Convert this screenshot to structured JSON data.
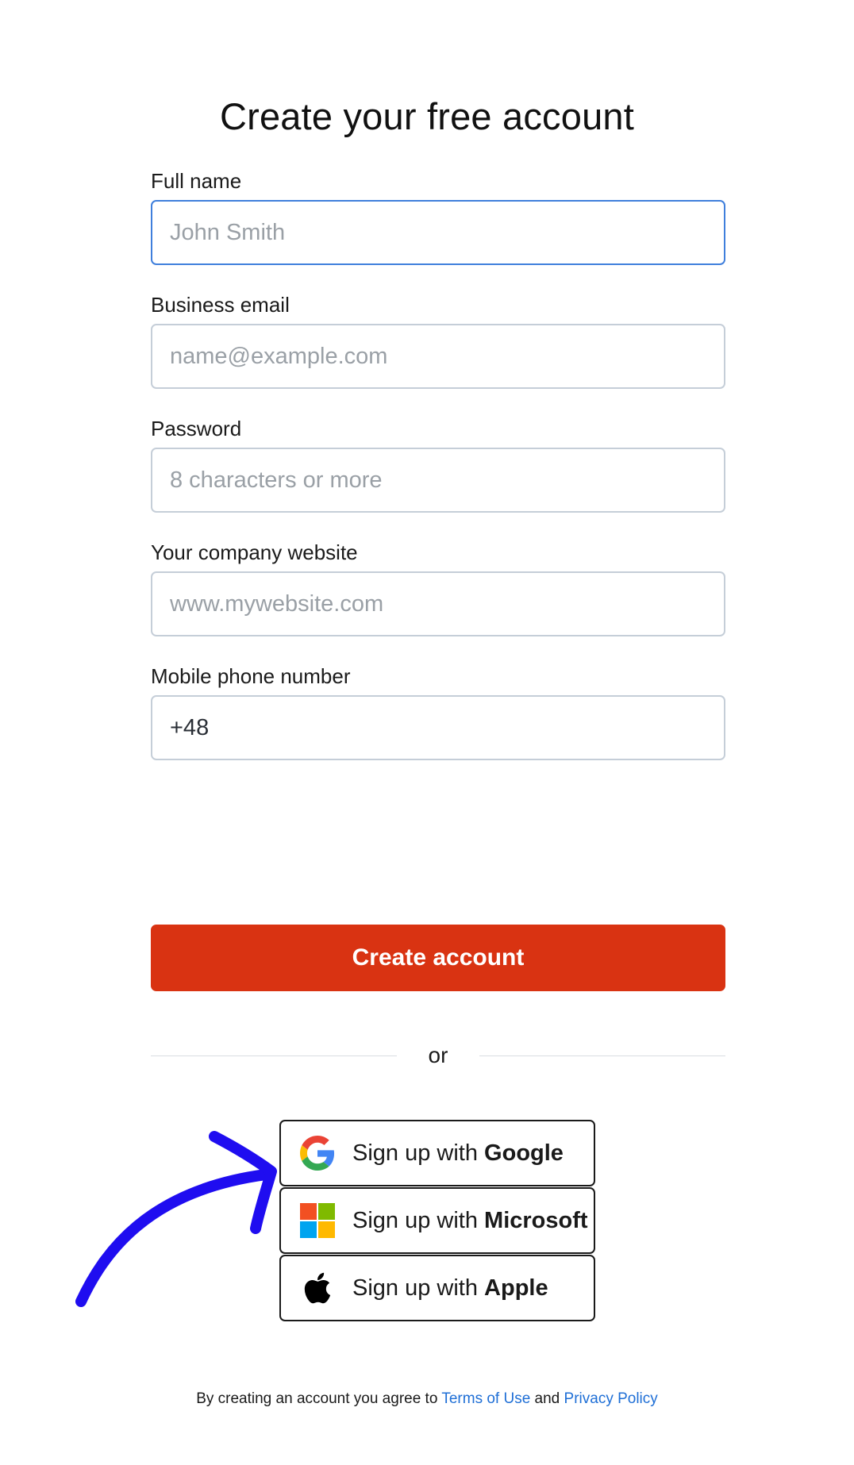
{
  "page": {
    "title": "Create your free account"
  },
  "form": {
    "fields": [
      {
        "label": "Full name",
        "placeholder": "John Smith",
        "value": ""
      },
      {
        "label": "Business email",
        "placeholder": "name@example.com",
        "value": ""
      },
      {
        "label": "Password",
        "placeholder": "8 characters or more",
        "value": ""
      },
      {
        "label": "Your company website",
        "placeholder": "www.mywebsite.com",
        "value": ""
      },
      {
        "label": "Mobile phone number",
        "placeholder": "",
        "value": "+48"
      }
    ],
    "submit_label": "Create account"
  },
  "divider": {
    "text": "or"
  },
  "social": {
    "prefix": "Sign up with ",
    "google": "Google",
    "microsoft": "Microsoft",
    "apple": "Apple"
  },
  "footer": {
    "text_before": "By creating an account you agree to ",
    "terms_label": "Terms of Use",
    "text_middle": " and ",
    "privacy_label": "Privacy Policy"
  },
  "colors": {
    "primary_button": "#d93312",
    "focus_border": "#3f7fdc",
    "link": "#1f6fd6",
    "arrow": "#1f0df0"
  }
}
